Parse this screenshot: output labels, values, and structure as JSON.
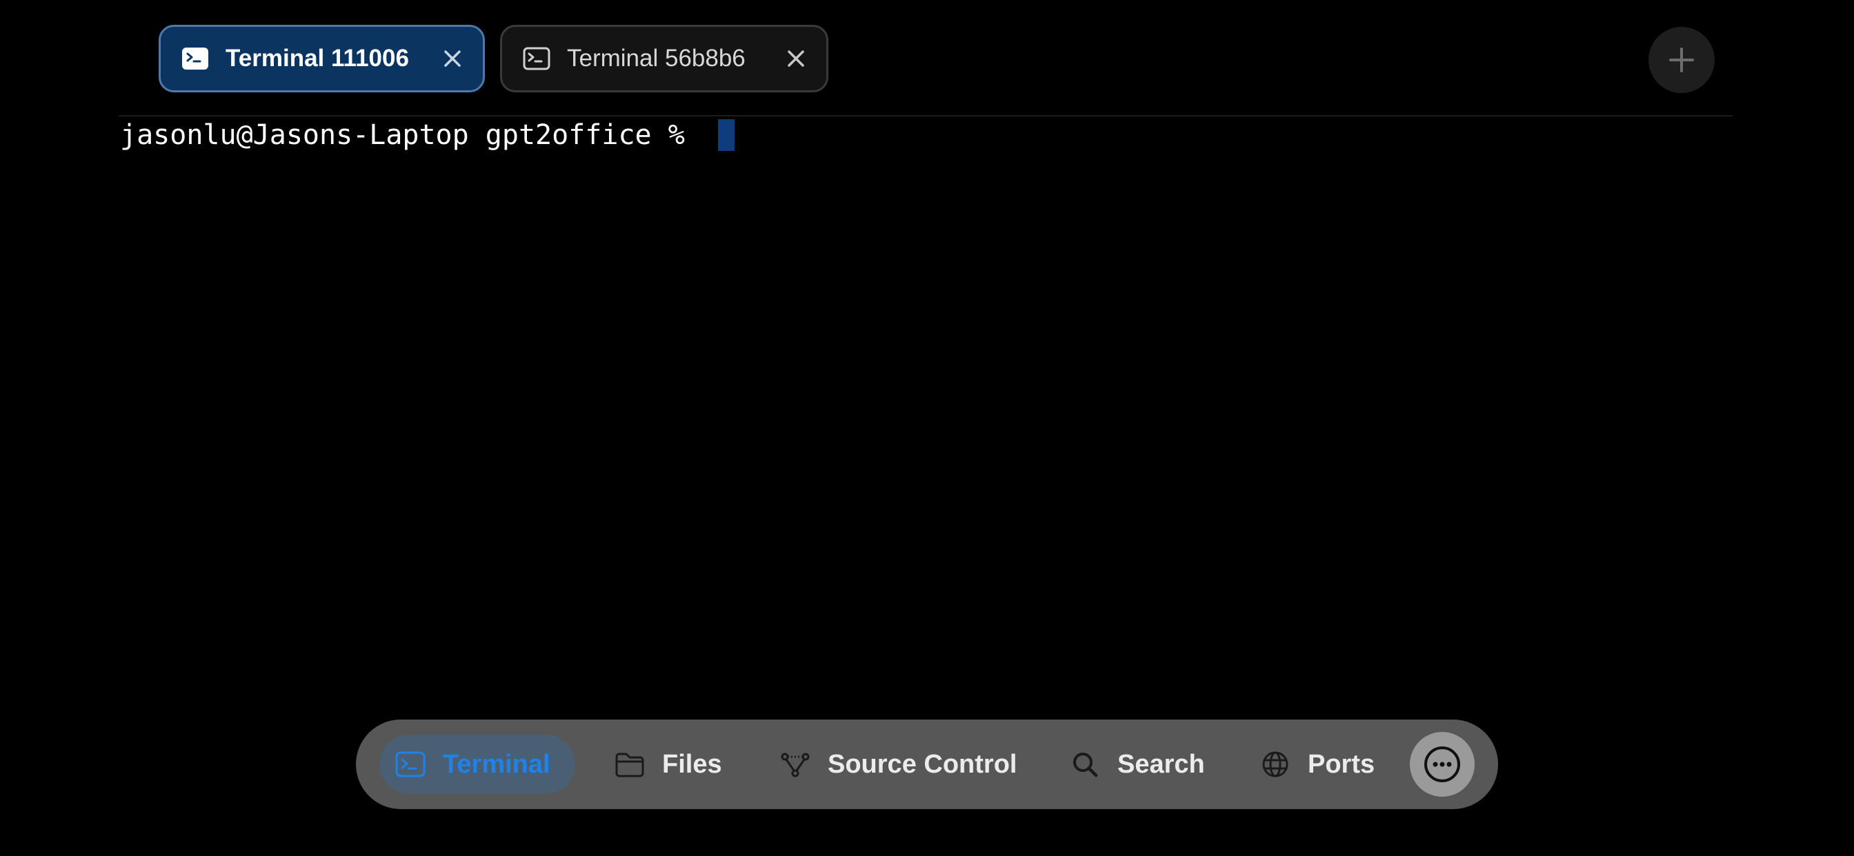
{
  "tabs": [
    {
      "label": "Terminal 111006",
      "active": true
    },
    {
      "label": "Terminal 56b8b6",
      "active": false
    }
  ],
  "terminal": {
    "prompt": "jasonlu@Jasons-Laptop gpt2office % "
  },
  "dock": {
    "items": [
      {
        "label": "Terminal",
        "icon": "terminal-icon",
        "active": true
      },
      {
        "label": "Files",
        "icon": "folder-icon",
        "active": false
      },
      {
        "label": "Source Control",
        "icon": "source-control-icon",
        "active": false
      },
      {
        "label": "Search",
        "icon": "search-icon",
        "active": false
      },
      {
        "label": "Ports",
        "icon": "globe-icon",
        "active": false
      }
    ]
  },
  "colors": {
    "background": "#000000",
    "active_tab": "#0b3460",
    "accent": "#1f82e8",
    "cursor": "#0d3d7a",
    "dock": "#575757"
  }
}
